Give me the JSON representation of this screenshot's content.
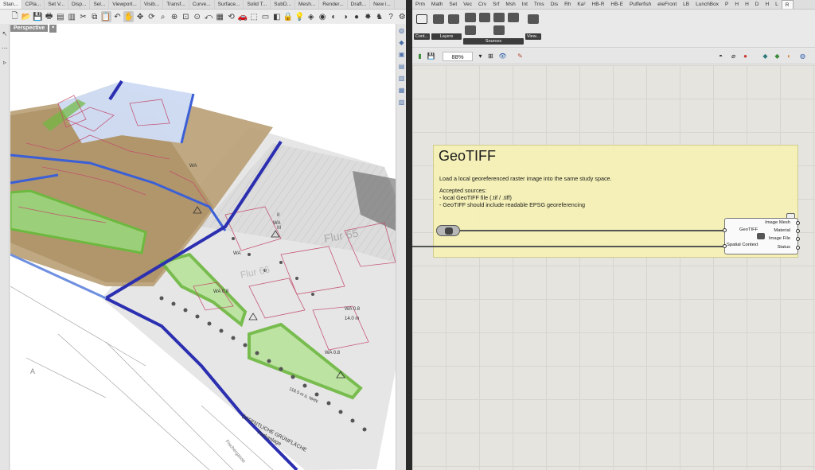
{
  "rhino": {
    "tabs": [
      "Stan...",
      "CPla...",
      "Set V...",
      "Disp...",
      "Sel...",
      "Viewport...",
      "Visib...",
      "Transf...",
      "Curve...",
      "Surface...",
      "Solid T...",
      "SubD...",
      "Mesh...",
      "Render...",
      "Draft...",
      "New i..."
    ],
    "viewport_label": "Perspective",
    "viewport_dropdown": "▾",
    "map_labels": [
      "Flur 65",
      "Flur 66",
      "ÖFFENTLICHE GRÜNFLÄCHE",
      "Parkanlage",
      "WA",
      "WA",
      "WA",
      "WA 0.8",
      "WA 0.8",
      "WA 0.8",
      "Fischergasse",
      "A",
      "II",
      "III",
      "14.0 m",
      "118.5 m ü. NHN"
    ]
  },
  "grasshopper": {
    "tabs": [
      "Prm",
      "Math",
      "Set",
      "Vec",
      "Crv",
      "Srf",
      "Msh",
      "Int",
      "Trns",
      "Dis",
      "Rh",
      "Ka²",
      "HB-R",
      "HB-E",
      "Pufferfish",
      "eleFront",
      "LB",
      "LunchBox",
      "P",
      "H",
      "H",
      "D",
      "H",
      "L",
      "R"
    ],
    "ribbon_groups": [
      "Cont...",
      "Layers",
      "Sources",
      "View..."
    ],
    "zoom": "88%",
    "group": {
      "title": "GeoTIFF",
      "line1": "Load a local georeferenced raster image into the same study space.",
      "line2": "Accepted sources:",
      "line3": "- local GeoTIFF file (.tif / .tiff)",
      "line4": "- GeoTIFF should include readable EPSG georeferencing"
    },
    "component": {
      "name": "GeoTIFF",
      "input": "Spatial Context",
      "outputs": [
        "Image Mesh",
        "Material",
        "Image File",
        "Status"
      ]
    },
    "colors": {
      "group_bg": "#f5f1b5",
      "canvas": "#e5e4df",
      "accent_red": "#cc3333"
    }
  }
}
